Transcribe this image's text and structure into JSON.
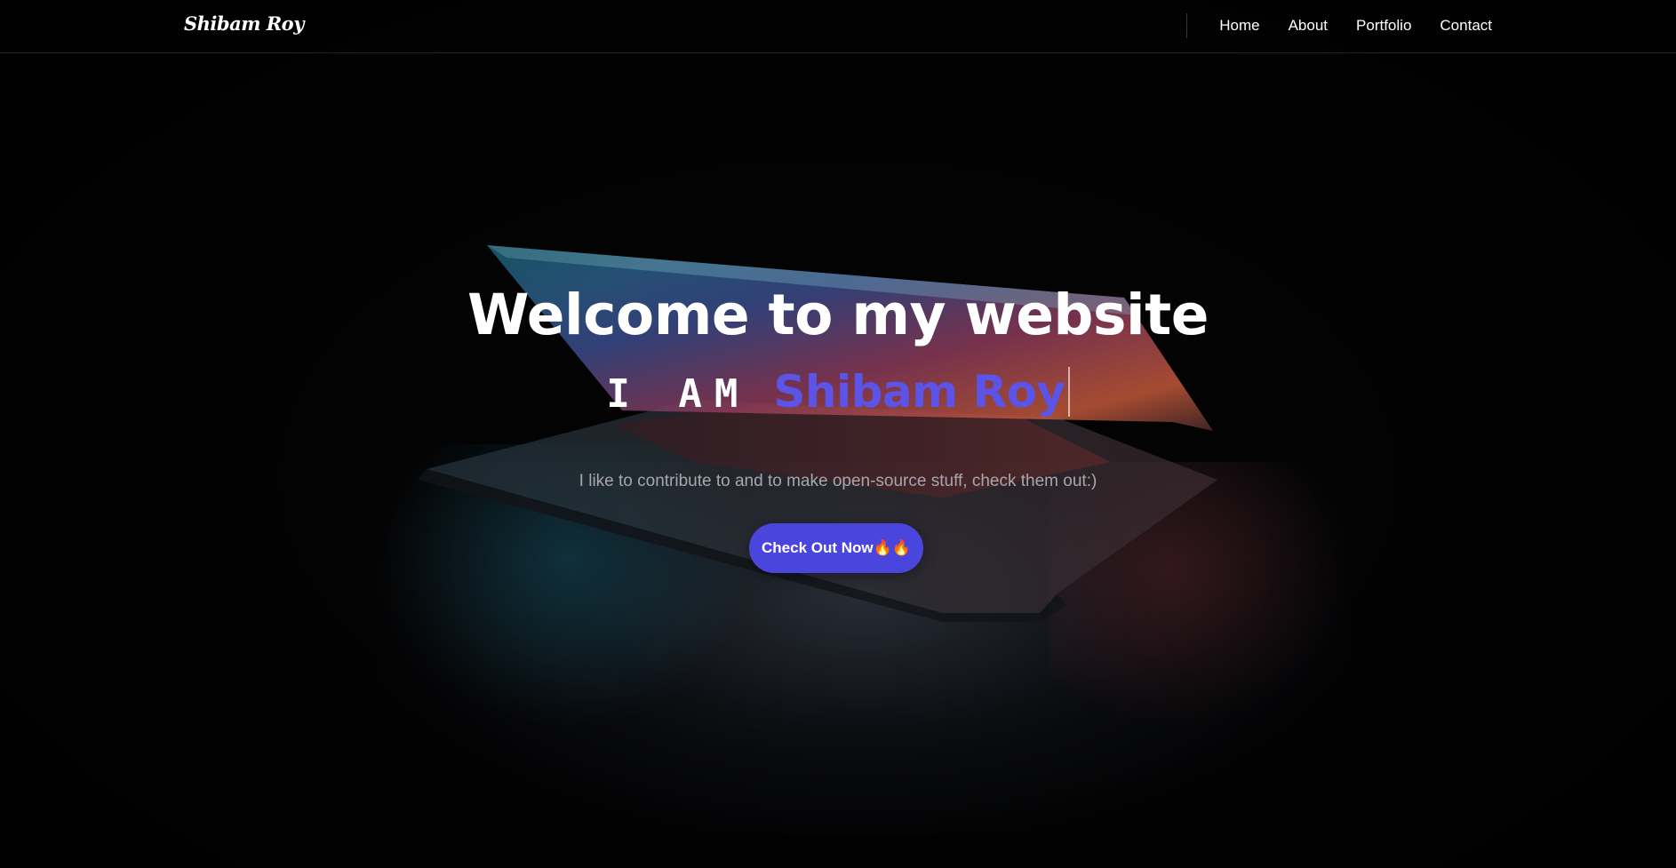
{
  "navbar": {
    "brand": "Shibam Roy",
    "links": [
      "Home",
      "About",
      "Portfolio",
      "Contact"
    ]
  },
  "hero": {
    "title": "Welcome to my website",
    "prefix": "I AM",
    "typed_name": "Shibam Roy",
    "subtitle": "I like to contribute to and to make open-source stuff, check them out:)",
    "cta_label": "Check Out Now🔥🔥"
  },
  "colors": {
    "accent": "#4a46dd",
    "typed_text": "#5b54e6",
    "background": "#030304"
  }
}
